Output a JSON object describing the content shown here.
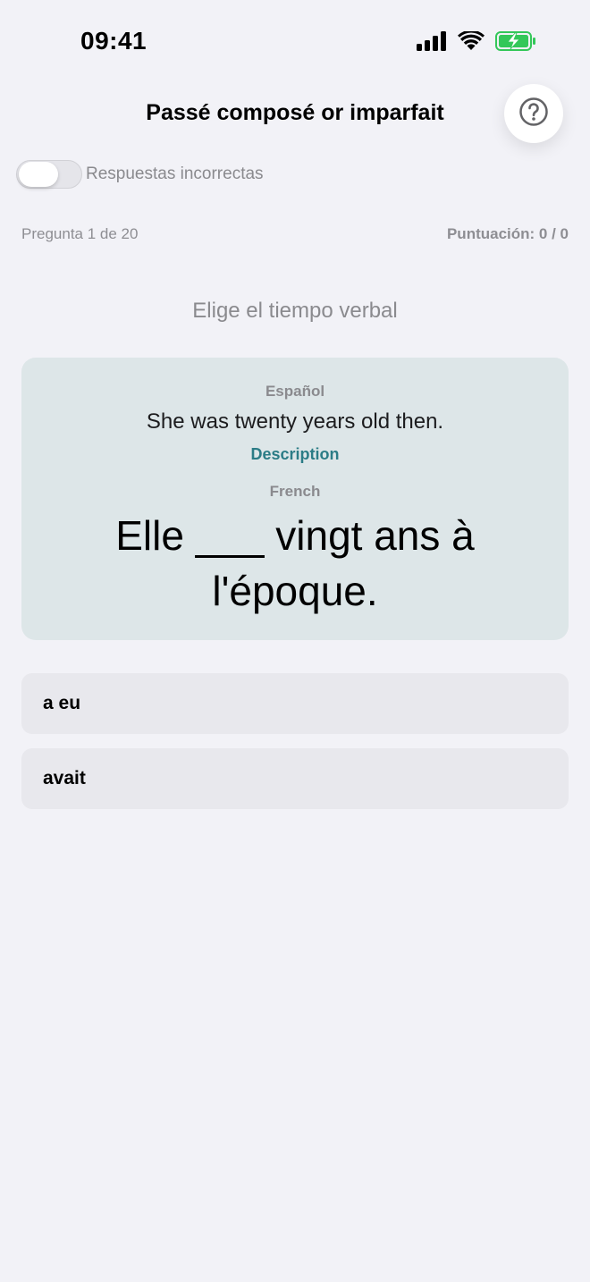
{
  "status_bar": {
    "time": "09:41",
    "icons": [
      "cellular-signal-icon",
      "wifi-icon",
      "battery-charging-icon"
    ],
    "battery_color": "#34c759"
  },
  "header": {
    "title": "Passé composé or imparfait",
    "help_icon": "question-mark-icon"
  },
  "toggle": {
    "label": "Respuestas incorrectas",
    "on": false
  },
  "progress": {
    "question_text": "Pregunta 1 de 20",
    "score_text": "Puntuación: 0 / 0"
  },
  "instruction": "Elige el tiempo verbal",
  "card": {
    "source_language": "Español",
    "source_sentence": "She was twenty years old then.",
    "hint": "Description",
    "target_language": "French",
    "target_sentence": "Elle ___ vingt ans à l'époque.",
    "background": "#dde6e8",
    "hint_color": "#2b7c86"
  },
  "options": [
    {
      "label": "a eu"
    },
    {
      "label": "avait"
    }
  ]
}
